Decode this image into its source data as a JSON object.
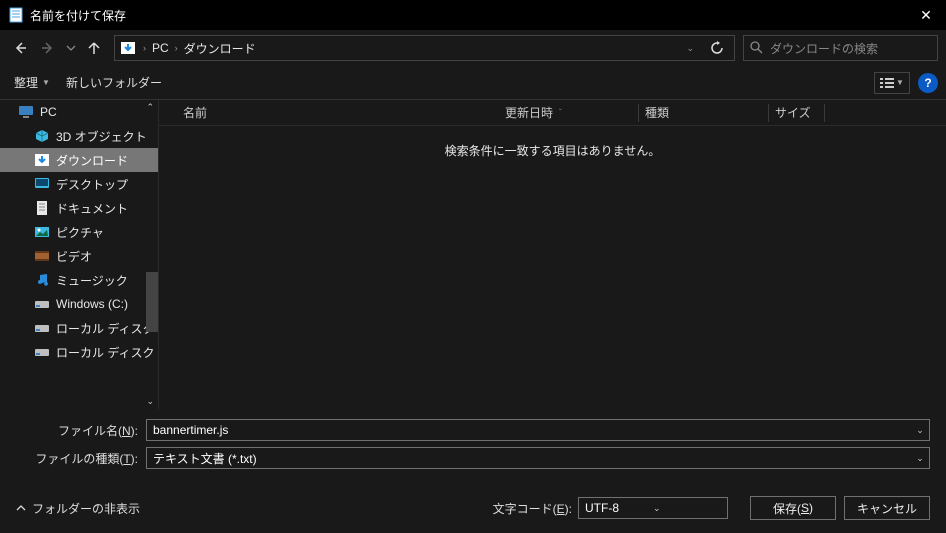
{
  "titlebar": {
    "title": "名前を付けて保存"
  },
  "nav": {
    "breadcrumb": [
      "PC",
      "ダウンロード"
    ]
  },
  "search": {
    "placeholder": "ダウンロードの検索"
  },
  "toolbar": {
    "organize": "整理",
    "newfolder": "新しいフォルダー"
  },
  "tree": {
    "items": [
      {
        "label": "PC",
        "icon": "pc",
        "lv": 0
      },
      {
        "label": "3D オブジェクト",
        "icon": "3d",
        "lv": 1
      },
      {
        "label": "ダウンロード",
        "icon": "download",
        "lv": 1,
        "sel": true
      },
      {
        "label": "デスクトップ",
        "icon": "desktop",
        "lv": 1
      },
      {
        "label": "ドキュメント",
        "icon": "document",
        "lv": 1
      },
      {
        "label": "ピクチャ",
        "icon": "picture",
        "lv": 1
      },
      {
        "label": "ビデオ",
        "icon": "video",
        "lv": 1
      },
      {
        "label": "ミュージック",
        "icon": "music",
        "lv": 1
      },
      {
        "label": "Windows (C:)",
        "icon": "drive",
        "lv": 1
      },
      {
        "label": "ローカル ディスク (D:)",
        "icon": "drive",
        "lv": 1
      },
      {
        "label": "ローカル ディスク (E:)",
        "icon": "drive",
        "lv": 1
      }
    ]
  },
  "columns": {
    "name": "名前",
    "date": "更新日時",
    "type": "種類",
    "size": "サイズ"
  },
  "empty": "検索条件に一致する項目はありません。",
  "form": {
    "filename_label_pre": "ファイル名(",
    "filename_label_key": "N",
    "filename_label_post": "):",
    "filetype_label_pre": "ファイルの種類(",
    "filetype_label_key": "T",
    "filetype_label_post": "):",
    "filename": "bannertimer.js",
    "filetype": "テキスト文書 (*.txt)"
  },
  "footer": {
    "hidefolder": "フォルダーの非表示",
    "encoding_label_pre": "文字コード(",
    "encoding_label_key": "E",
    "encoding_label_post": "):",
    "encoding": "UTF-8",
    "save_pre": "保存(",
    "save_key": "S",
    "save_post": ")",
    "cancel": "キャンセル"
  },
  "help": "?"
}
